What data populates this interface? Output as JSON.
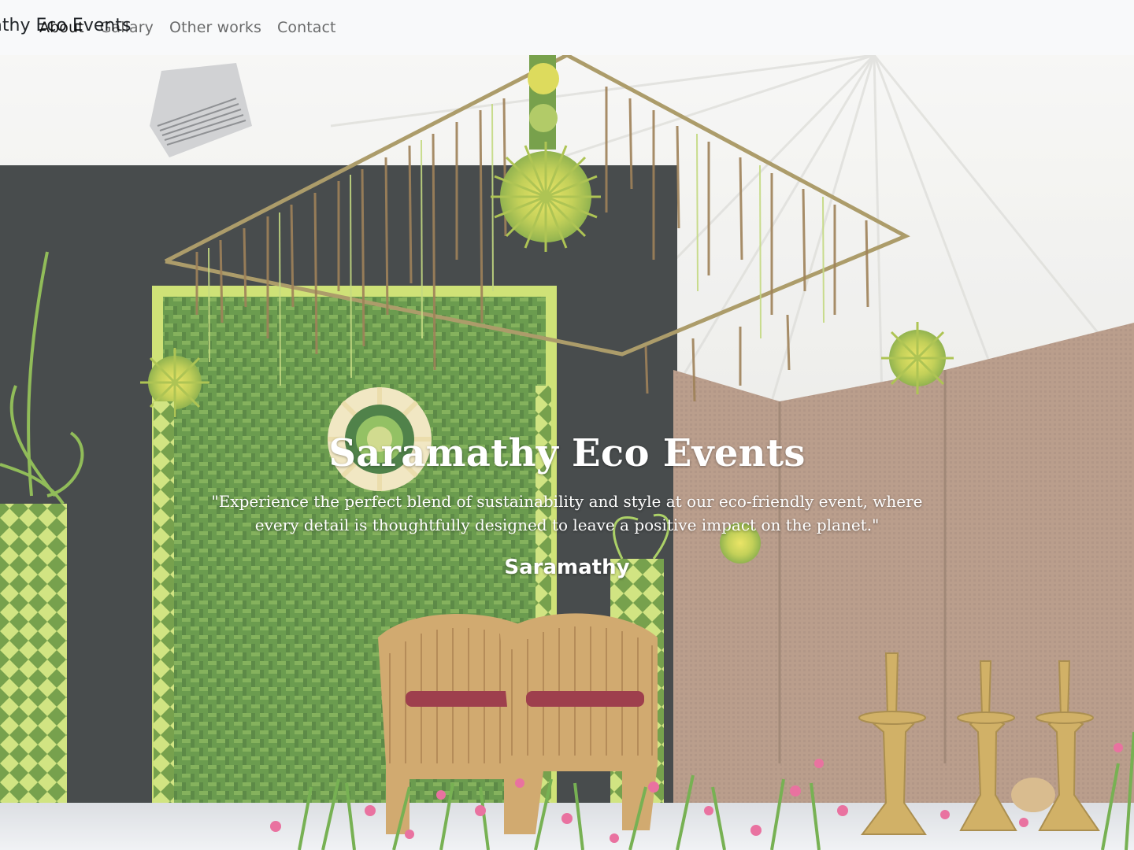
{
  "navbar": {
    "brand": "Saramathy Eco Events",
    "links": [
      {
        "label": "About",
        "active": true
      },
      {
        "label": "Gallary",
        "active": false
      },
      {
        "label": "Other works",
        "active": false
      },
      {
        "label": "Contact",
        "active": false
      }
    ]
  },
  "hero": {
    "title": "Saramathy Eco Events",
    "quote": "\"Experience the perfect blend of sustainability and style at our eco-friendly event, where every detail is thoughtfully designed to leave a positive impact on the planet.\"",
    "signature": "Saramathy"
  },
  "colors": {
    "navbar_bg": "#f8f9fa",
    "leaf_green": "#6fa23a",
    "woven_green": "#a6c94a",
    "wall_brown": "#a98a75",
    "tent_white": "#f3f3f1",
    "brass": "#c9a34a",
    "cane": "#c99a55",
    "cushion_red": "#8c1b2b",
    "flower_pink": "#e5588e"
  }
}
